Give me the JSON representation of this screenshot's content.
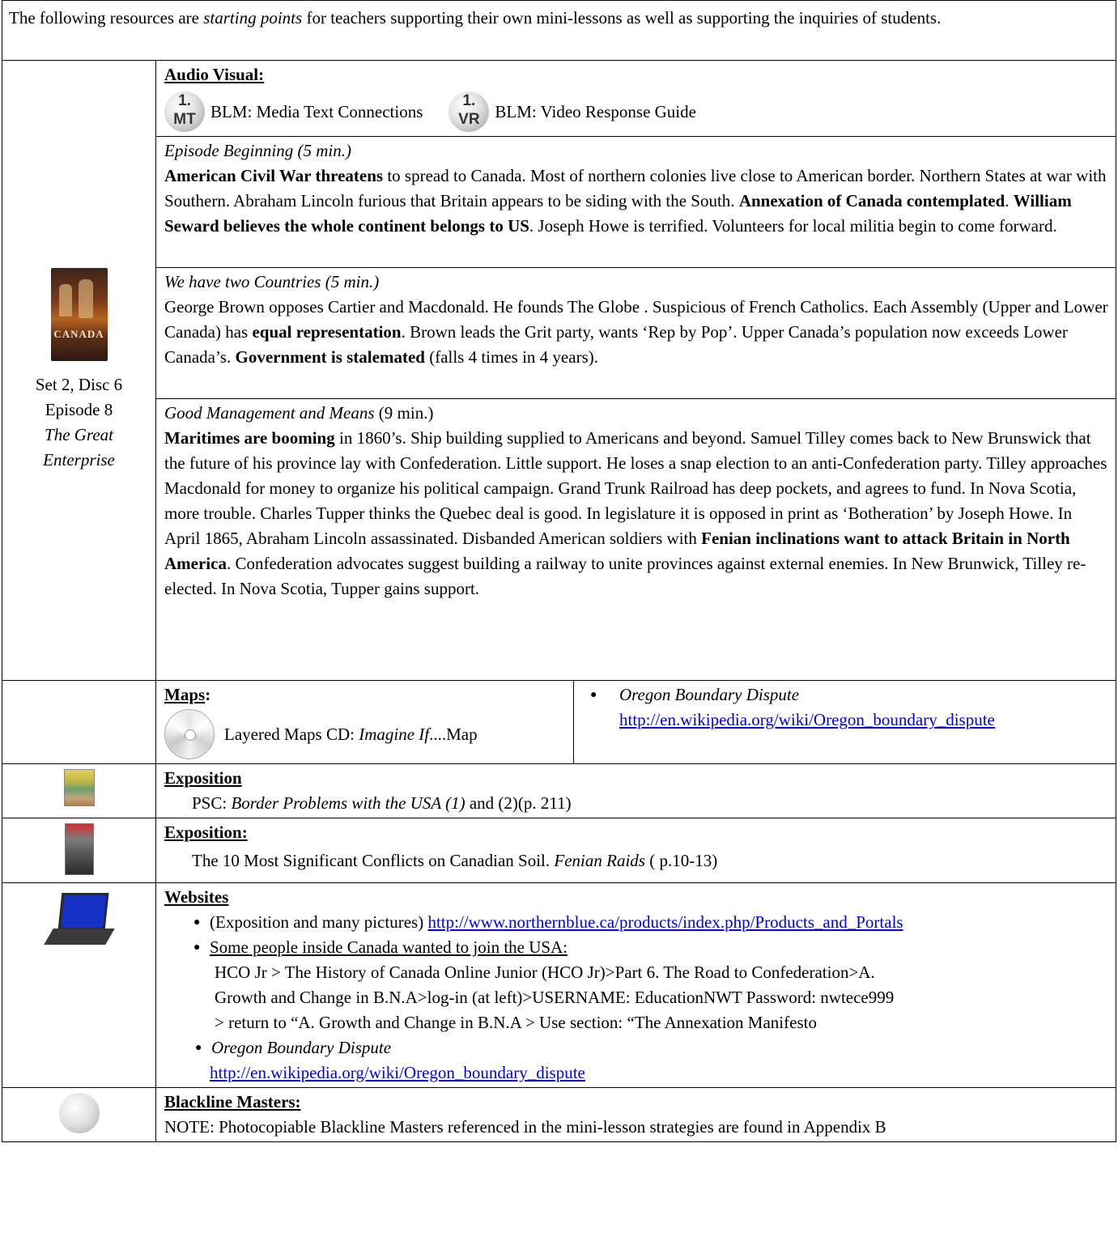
{
  "intro": {
    "text_a": "The following resources are ",
    "text_em": "starting points",
    "text_b": " for teachers supporting their own mini-lessons as well as supporting the inquiries of students."
  },
  "left": {
    "dvd_title": "CANADA",
    "line1": "Set 2, Disc 6",
    "line2": "Episode 8",
    "line3": "The Great",
    "line4": "Enterprise"
  },
  "audio_visual": {
    "heading": "Audio Visual:",
    "icon1_top": "1.",
    "icon1_bottom": "MT",
    "label1": "BLM: Media Text Connections",
    "icon2_top": "1.",
    "icon2_bottom": "VR",
    "label2": "BLM: Video Response Guide"
  },
  "segments": {
    "s1": {
      "title": "Episode Beginning  (5 min.)",
      "p1b": "American Civil War threatens",
      "p1": " to spread to Canada.  Most of northern colonies live close to American border. Northern States at war with Southern. Abraham Lincoln furious that Britain appears to be siding with the South. ",
      "p2b": "Annexation of Canada contemplated",
      "p2": ". ",
      "p3b": "William Seward believes the whole continent belongs to US",
      "p3": ".  Joseph Howe is terrified. Volunteers for local militia begin to come forward."
    },
    "s2": {
      "title": "We have two Countries (5 min.)",
      "p1": "George Brown opposes Cartier and Macdonald.  He founds The Globe . Suspicious of French Catholics. Each Assembly (Upper and Lower Canada) has ",
      "p2b": "equal representation",
      "p2": ". Brown leads the Grit party, wants ‘Rep by Pop’. Upper Canada’s population now exceeds Lower Canada’s.  ",
      "p3b": "Government is stalemated",
      "p3": " (falls 4 times in 4 years)."
    },
    "s3": {
      "title_i": "Good Management and Means",
      "title": " (9 min.)",
      "p1b": "Maritimes are booming",
      "p1": " in 1860’s. Ship building supplied to Americans and beyond.  Samuel Tilley comes back to New Brunswick that the future of his province lay with Confederation. Little support. He loses a snap election to an anti-Confederation party.  Tilley approaches Macdonald for money to organize his political campaign.  Grand Trunk Railroad has deep pockets, and agrees to fund.  In Nova Scotia, more trouble. Charles Tupper thinks the Quebec deal is good. In legislature it is opposed in print as ‘Botheration’ by Joseph Howe. In April 1865, Abraham Lincoln assassinated. Disbanded American soldiers with ",
      "p2b": "Fenian inclinations want to attack Britain in North America",
      "p2": ".   Confederation advocates suggest building a railway to unite provinces against external enemies.  In New Brunwick, Tilley re-elected. In Nova Scotia, Tupper gains support."
    }
  },
  "maps": {
    "heading": "Maps",
    "colon": ":",
    "label_a": "Layered Maps CD:  ",
    "label_i": "Imagine If",
    "label_b": "....Map",
    "bullet": "Oregon Boundary Dispute",
    "link": "http://en.wikipedia.org/wiki/Oregon_boundary_dispute"
  },
  "exposition1": {
    "heading": "Exposition",
    "a": "PSC: ",
    "i": "Border Problems with the USA (1)",
    "b": " and (2)(p. 211)"
  },
  "exposition2": {
    "heading": "Exposition:",
    "a": "The 10 Most Significant Conflicts on Canadian Soil. ",
    "i": "Fenian Raids",
    "b": " ( p.10-13)"
  },
  "websites": {
    "heading": "Websites",
    "b1_a": "(Exposition and many pictures) ",
    "b1_link": "http://www.northernblue.ca/products/index.php/Products_and_Portals",
    "b2_u": "Some people inside Canada wanted to join the USA:",
    "b2_l1": "HCO Jr > The History of Canada Online Junior (HCO Jr)>Part 6. The Road to Confederation>A.",
    "b2_l2": "Growth and Change in B.N.A>log-in (at left)>USERNAME: EducationNWT   Password: nwtece999",
    "b2_l3": "> return to “A. Growth and Change in B.N.A > Use section:  “The Annexation Manifesto",
    "b3": "Oregon Boundary Dispute",
    "b3_link": "http://en.wikipedia.org/wiki/Oregon_boundary_dispute"
  },
  "blackline": {
    "heading": "Blackline Masters:",
    "note": "NOTE:  Photocopiable Blackline Masters referenced in  the mini-lesson strategies are found in Appendix B"
  }
}
